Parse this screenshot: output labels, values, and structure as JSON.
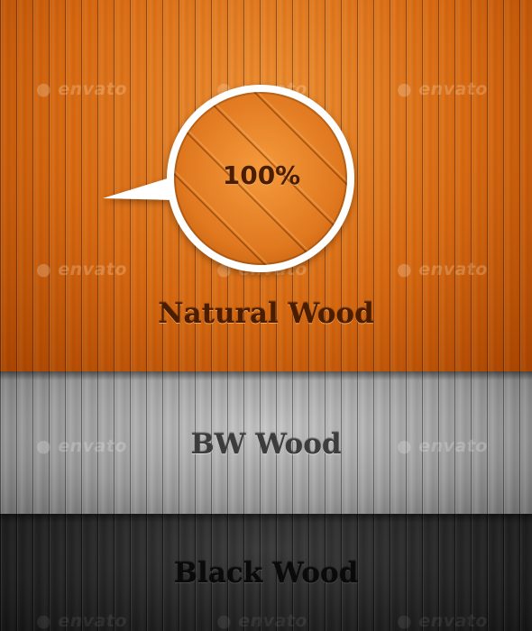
{
  "panels": {
    "natural": {
      "title": "Natural Wood",
      "percent": "100%"
    },
    "bw": {
      "title": "BW Wood"
    },
    "black": {
      "title": "Black Wood"
    }
  },
  "watermark_text": "envato",
  "colors": {
    "natural_base": "#d86a12",
    "bw_base": "#9a9a9a",
    "black_base": "#232323",
    "bubble_border": "#ffffff"
  }
}
